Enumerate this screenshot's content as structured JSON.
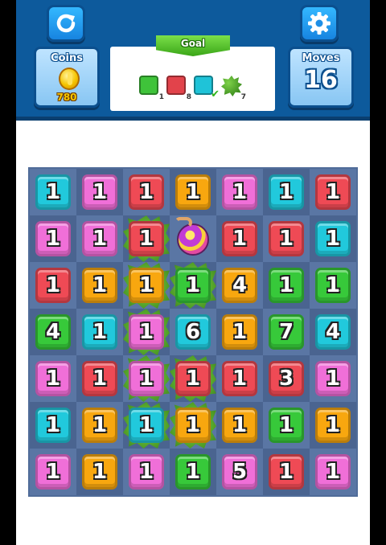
{
  "header": {
    "refresh_icon": "refresh-icon",
    "settings_icon": "gear-icon",
    "coins": {
      "label": "Coins",
      "value": "780",
      "icon": "coin-icon"
    },
    "moves": {
      "label": "Moves",
      "value": "16"
    },
    "goal": {
      "title": "Goal",
      "items": [
        {
          "kind": "tile",
          "color": "#3fc33a",
          "count": "1",
          "done": false
        },
        {
          "kind": "tile",
          "color": "#e2434b",
          "count": "8",
          "done": false
        },
        {
          "kind": "tile",
          "color": "#1fc3d8",
          "count": "",
          "done": true
        },
        {
          "kind": "leaf",
          "color": "#5aa92c",
          "count": "7",
          "done": false
        }
      ]
    }
  },
  "colors": {
    "cyan": "#21c9dc",
    "pink": "#f06fd8",
    "red": "#ef4a55",
    "orange": "#f8a70f",
    "green": "#37c93a",
    "bomb": "#c23bd6"
  },
  "board": {
    "rows": [
      [
        {
          "c": "cyan",
          "v": "1"
        },
        {
          "c": "pink",
          "v": "1"
        },
        {
          "c": "red",
          "v": "1"
        },
        {
          "c": "orange",
          "v": "1"
        },
        {
          "c": "pink",
          "v": "1"
        },
        {
          "c": "cyan",
          "v": "1"
        },
        {
          "c": "red",
          "v": "1"
        }
      ],
      [
        {
          "c": "pink",
          "v": "1"
        },
        {
          "c": "pink",
          "v": "1"
        },
        {
          "c": "red",
          "v": "1",
          "moss": true
        },
        {
          "c": "bomb",
          "v": "",
          "moss": false
        },
        {
          "c": "red",
          "v": "1"
        },
        {
          "c": "red",
          "v": "1"
        },
        {
          "c": "cyan",
          "v": "1"
        }
      ],
      [
        {
          "c": "red",
          "v": "1"
        },
        {
          "c": "orange",
          "v": "1"
        },
        {
          "c": "orange",
          "v": "1",
          "moss": true
        },
        {
          "c": "green",
          "v": "1",
          "moss": true
        },
        {
          "c": "orange",
          "v": "4"
        },
        {
          "c": "green",
          "v": "1"
        },
        {
          "c": "green",
          "v": "1"
        }
      ],
      [
        {
          "c": "green",
          "v": "4"
        },
        {
          "c": "cyan",
          "v": "1"
        },
        {
          "c": "pink",
          "v": "1",
          "moss": true
        },
        {
          "c": "cyan",
          "v": "6"
        },
        {
          "c": "orange",
          "v": "1"
        },
        {
          "c": "green",
          "v": "7"
        },
        {
          "c": "cyan",
          "v": "4"
        }
      ],
      [
        {
          "c": "pink",
          "v": "1"
        },
        {
          "c": "red",
          "v": "1"
        },
        {
          "c": "pink",
          "v": "1",
          "moss": true
        },
        {
          "c": "red",
          "v": "1",
          "moss": true
        },
        {
          "c": "red",
          "v": "1"
        },
        {
          "c": "red",
          "v": "3"
        },
        {
          "c": "pink",
          "v": "1"
        }
      ],
      [
        {
          "c": "cyan",
          "v": "1"
        },
        {
          "c": "orange",
          "v": "1"
        },
        {
          "c": "cyan",
          "v": "1",
          "moss": true
        },
        {
          "c": "orange",
          "v": "1",
          "moss": true
        },
        {
          "c": "orange",
          "v": "1"
        },
        {
          "c": "green",
          "v": "1"
        },
        {
          "c": "orange",
          "v": "1"
        }
      ],
      [
        {
          "c": "pink",
          "v": "1"
        },
        {
          "c": "orange",
          "v": "1"
        },
        {
          "c": "pink",
          "v": "1"
        },
        {
          "c": "green",
          "v": "1"
        },
        {
          "c": "pink",
          "v": "5"
        },
        {
          "c": "red",
          "v": "1"
        },
        {
          "c": "pink",
          "v": "1"
        }
      ]
    ]
  }
}
